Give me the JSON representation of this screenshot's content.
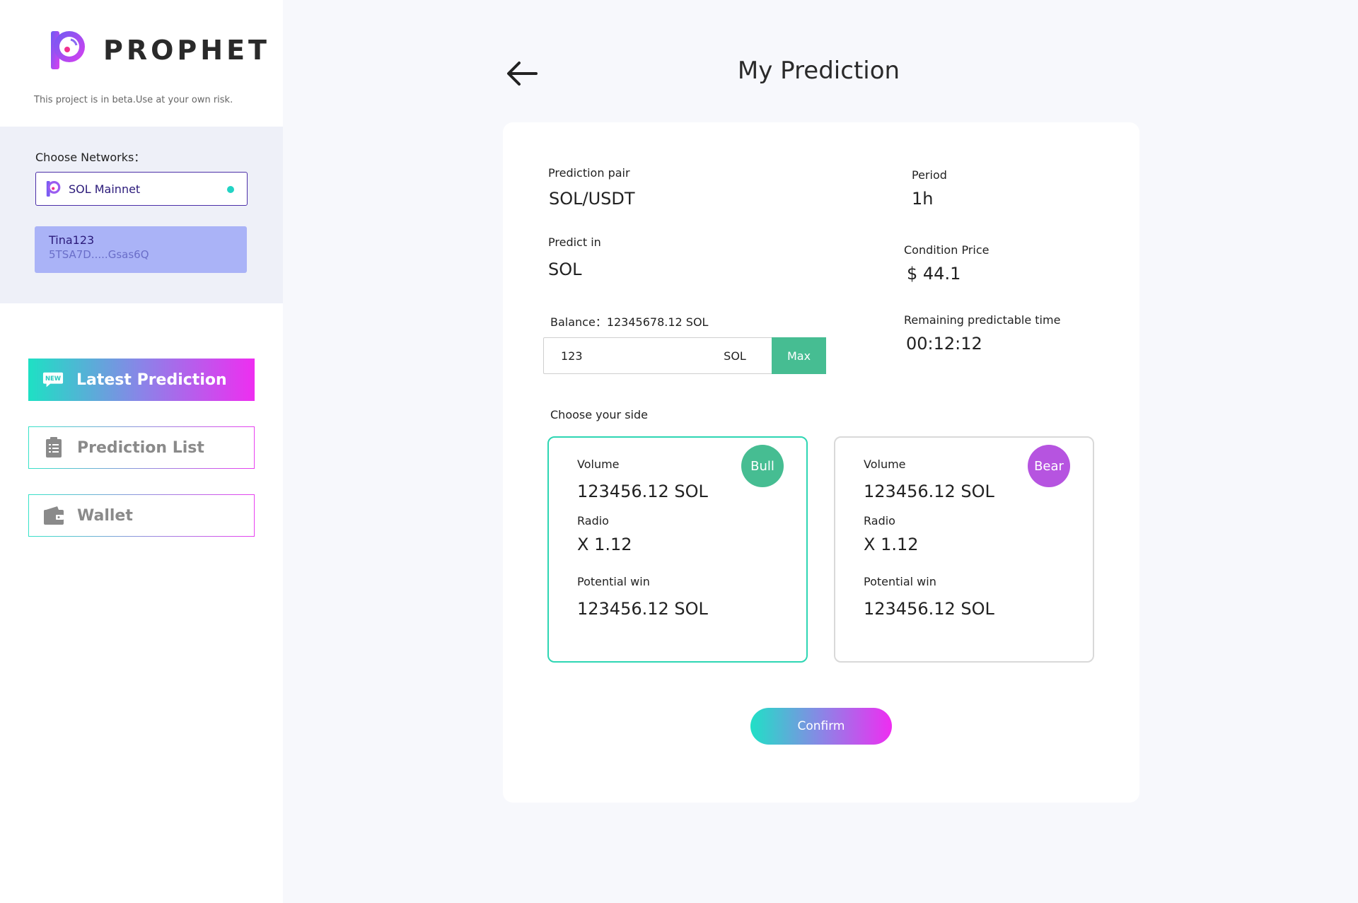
{
  "brand": {
    "name": "PROPHET",
    "beta_notice": "This project is in beta.Use at your own risk.",
    "colors": {
      "gradient_start": "#1ee0c4",
      "gradient_end": "#ee2ef0",
      "network_border": "#4b2fa8"
    }
  },
  "network": {
    "label": "Choose Networks：",
    "selected": "SOL Mainnet",
    "status_color": "#22d3c4"
  },
  "account": {
    "name": "Tina123",
    "address": "5TSA7D.....Gsas6Q"
  },
  "nav": {
    "items": [
      {
        "label": "Latest Prediction",
        "icon": "new-badge-icon",
        "active": true
      },
      {
        "label": "Prediction List",
        "icon": "clipboard-list-icon",
        "active": false
      },
      {
        "label": "Wallet",
        "icon": "wallet-icon",
        "active": false
      }
    ]
  },
  "page": {
    "title": "My Prediction",
    "back_icon": "arrow-left-icon"
  },
  "prediction": {
    "pair_label": "Prediction pair",
    "pair_value": "SOL/USDT",
    "period_label": "Period",
    "period_value": "1h",
    "predict_in_label": "Predict in",
    "predict_in_value": "SOL",
    "condition_label": "Condition Price",
    "condition_value": "$ 44.1",
    "balance_text": "Balance：12345678.12 SOL",
    "remaining_label": "Remaining predictable time",
    "remaining_value": "00:12:12",
    "amount_value": "123",
    "amount_unit": "SOL",
    "max_label": "Max",
    "choose_side_label": "Choose your side"
  },
  "sides": {
    "bull": {
      "badge": "Bull",
      "volume_label": "Volume",
      "volume_value": "123456.12 SOL",
      "radio_label": "Radio",
      "radio_value": "X 1.12",
      "win_label": "Potential win",
      "win_value": "123456.12 SOL",
      "selected": true
    },
    "bear": {
      "badge": "Bear",
      "volume_label": "Volume",
      "volume_value": "123456.12 SOL",
      "radio_label": "Radio",
      "radio_value": "X 1.12",
      "win_label": "Potential win",
      "win_value": "123456.12 SOL",
      "selected": false
    }
  },
  "actions": {
    "confirm_label": "Confirm"
  }
}
